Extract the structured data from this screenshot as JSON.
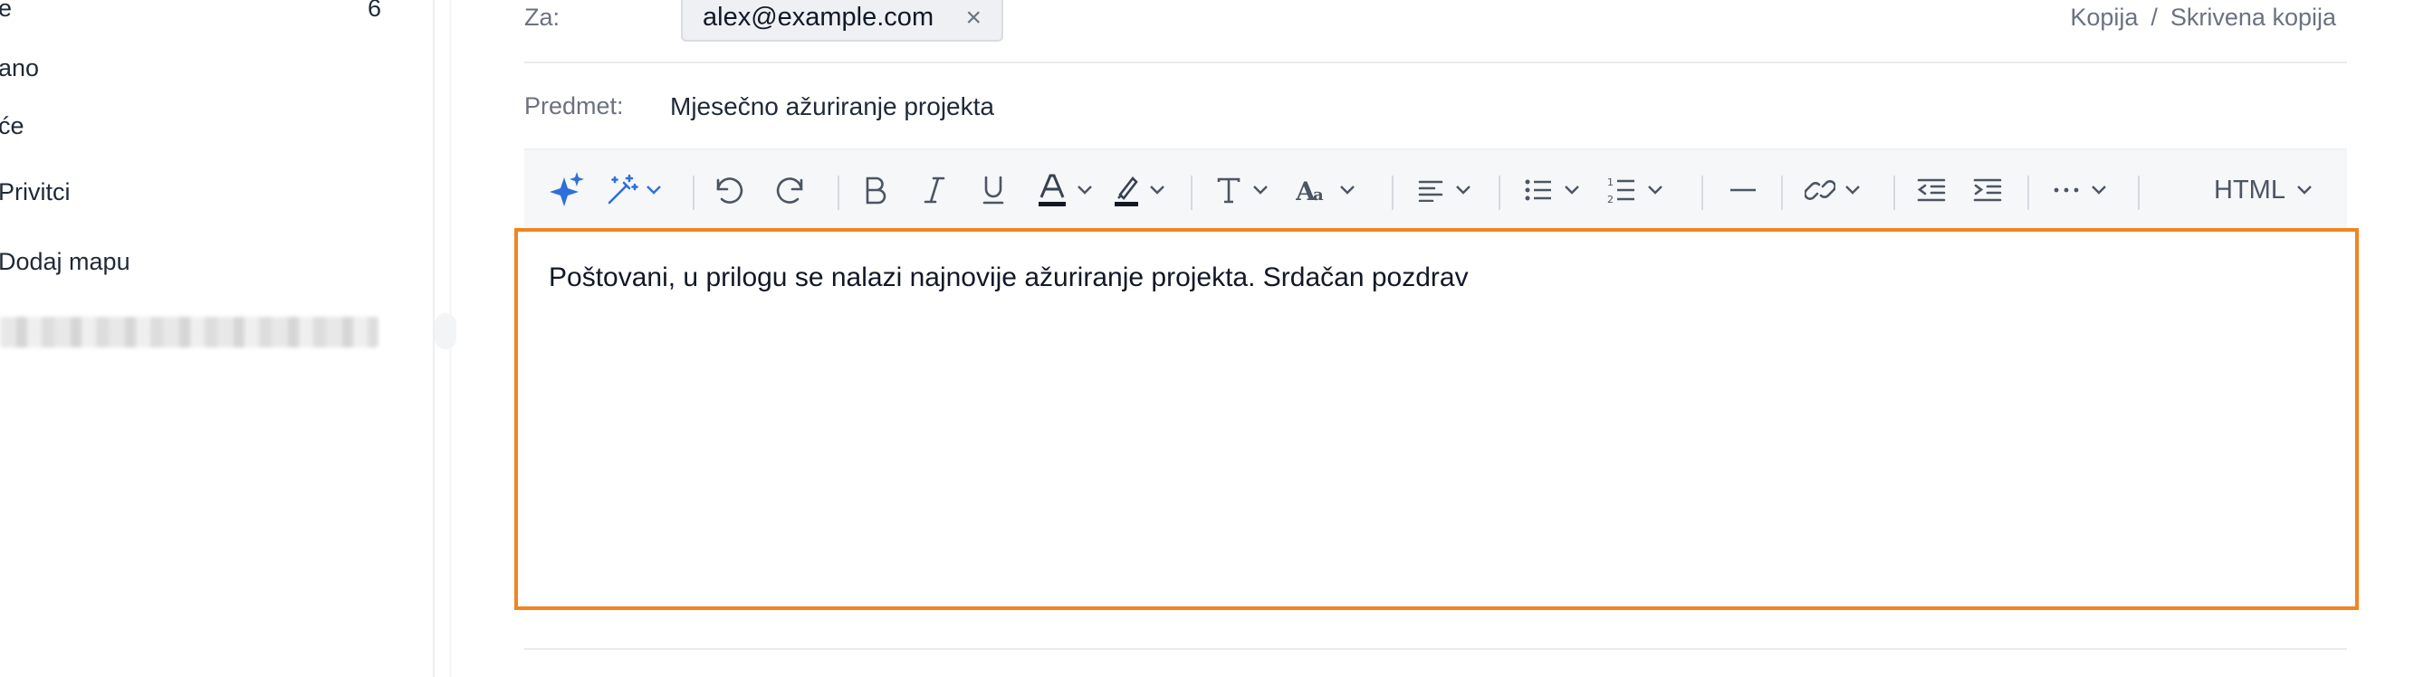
{
  "sidebar": {
    "items": [
      {
        "label": "e",
        "count": "6"
      },
      {
        "label": "ano"
      },
      {
        "label": "će"
      },
      {
        "label": "Privitci"
      },
      {
        "label": "Dodaj mapu"
      }
    ]
  },
  "compose": {
    "to_label": "Za:",
    "recipient": "alex@example.com",
    "remove_symbol": "×",
    "cc_label": "Kopija",
    "separator": "/",
    "bcc_label": "Skrivena kopija",
    "subject_label": "Predmet:",
    "subject_value": "Mjesečno ažuriranje projekta"
  },
  "toolbar": {
    "mode_label": "HTML",
    "icons": [
      "ai-sparkle-icon",
      "magic-wand-icon",
      "undo-icon",
      "redo-icon",
      "bold-icon",
      "italic-icon",
      "underline-icon",
      "font-color-icon",
      "highlight-icon",
      "text-style-icon",
      "font-size-icon",
      "align-icon",
      "bullet-list-icon",
      "numbered-list-icon",
      "horizontal-rule-icon",
      "link-icon",
      "outdent-icon",
      "indent-icon",
      "more-icon"
    ]
  },
  "editor": {
    "body": "Poštovani, u prilogu se nalazi najnovije ažuriranje projekta. Srdačan pozdrav"
  },
  "colors": {
    "accent": "#f08522",
    "ai_blue": "#2f6fdb",
    "text": "#1f2937",
    "muted": "#6b7280"
  }
}
